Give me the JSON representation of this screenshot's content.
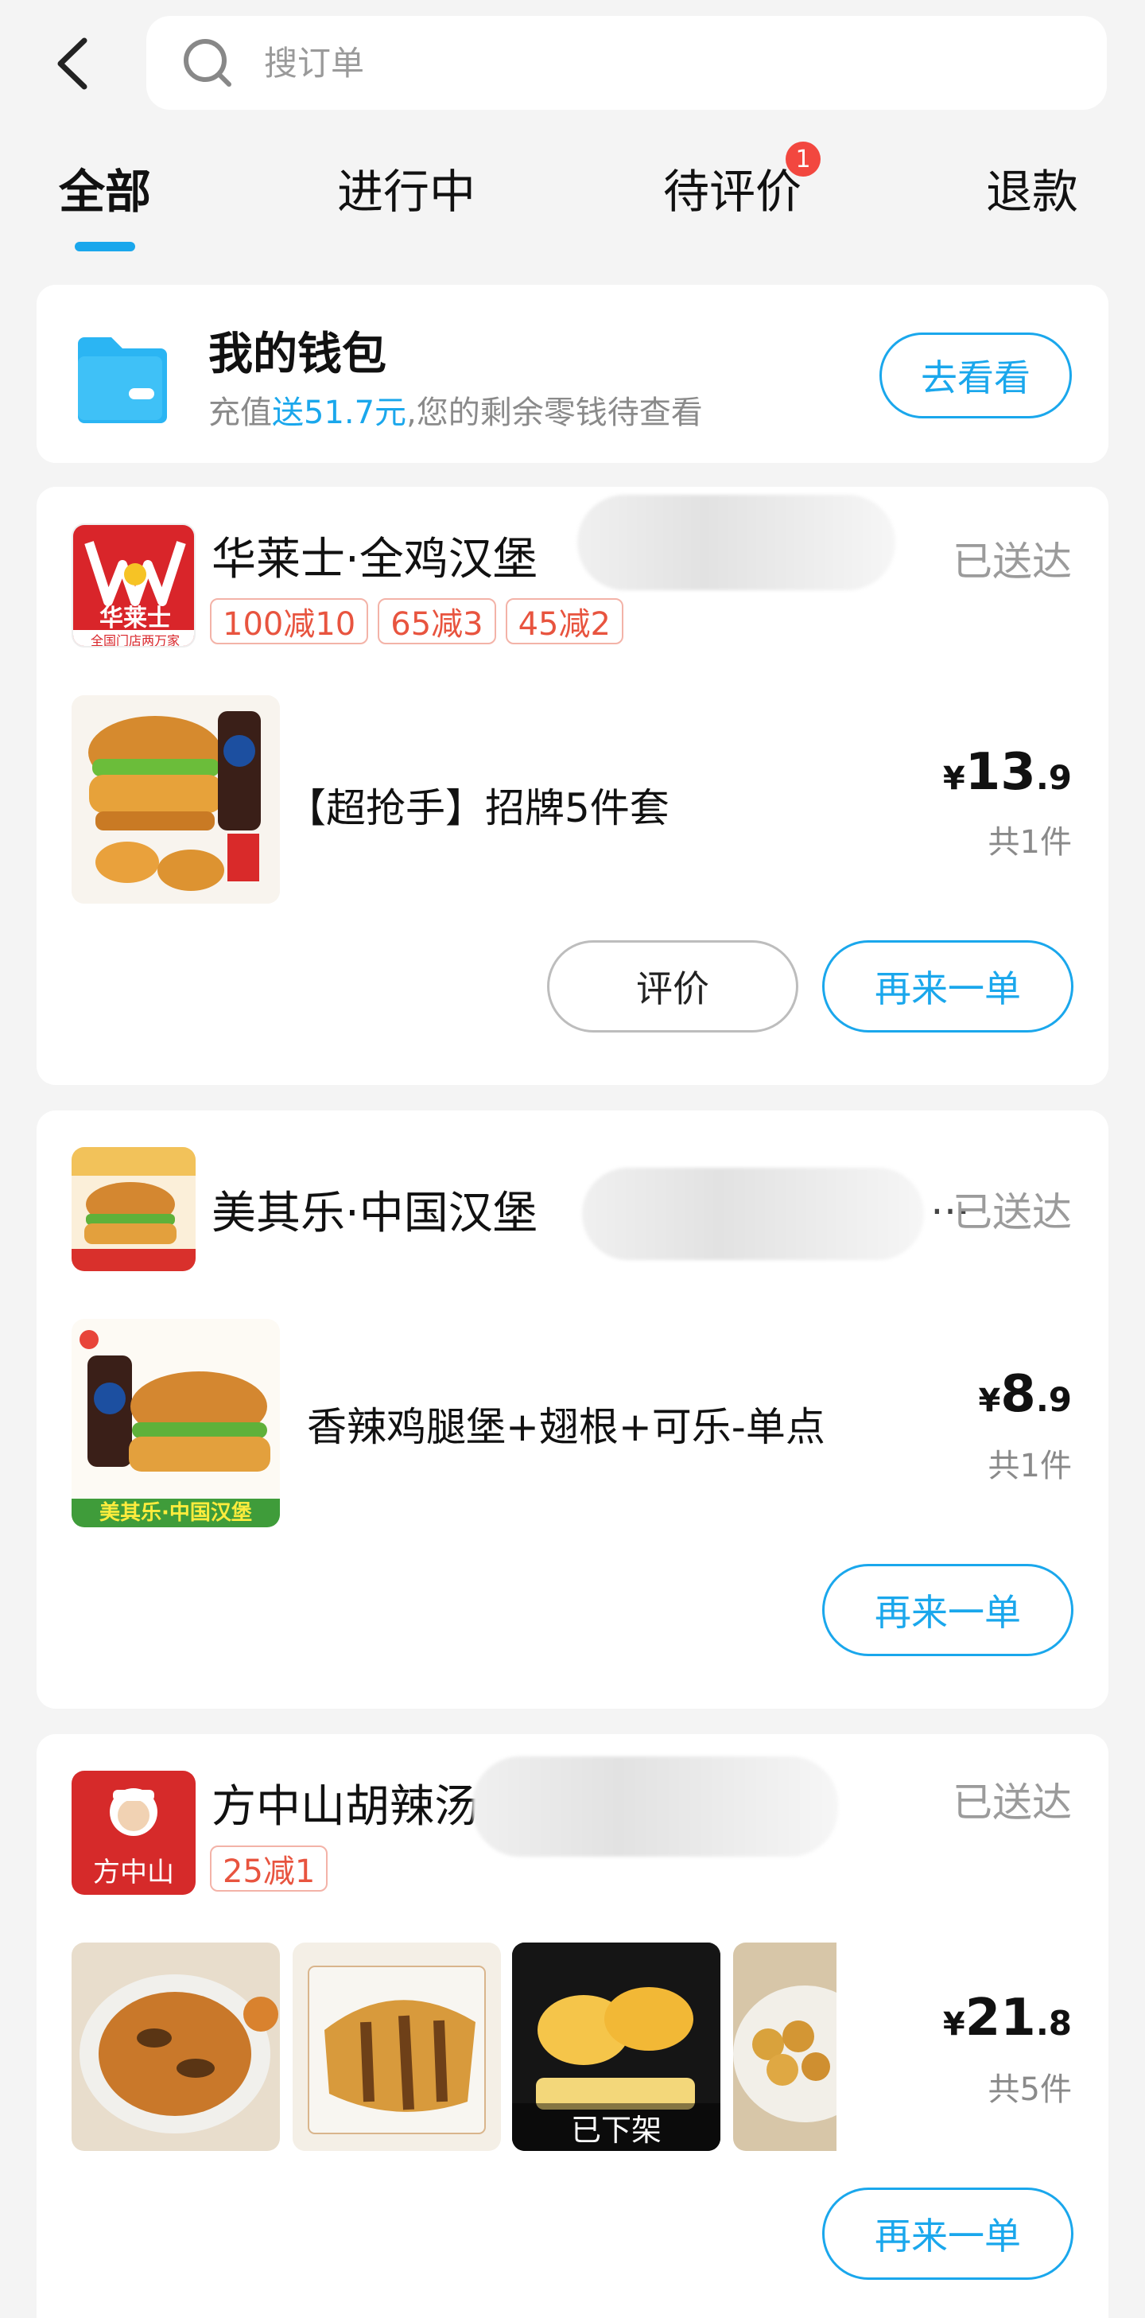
{
  "search": {
    "placeholder": "搜订单"
  },
  "tabs": [
    {
      "label": "全部",
      "active": true
    },
    {
      "label": "进行中"
    },
    {
      "label": "待评价",
      "badge": "1"
    },
    {
      "label": "退款"
    }
  ],
  "wallet": {
    "title": "我的钱包",
    "sub_prefix": "充值",
    "sub_highlight": "送51.7元",
    "sub_suffix": ",您的剩余零钱待查看",
    "button": "去看看"
  },
  "orders": [
    {
      "store": "华莱士·全鸡汉堡",
      "logo_text": "华莱士",
      "logo_caption": "全国门店两万家",
      "status": "已送达",
      "promos": [
        "100减10",
        "65减3",
        "45减2"
      ],
      "item": "【超抢手】招牌5件套",
      "price_currency": "¥",
      "price_int": "13",
      "price_dec": ".9",
      "count": "共1件",
      "buttons": [
        "评价",
        "再来一单"
      ]
    },
    {
      "store": "美其乐·中国汉堡",
      "ellipsis": "…",
      "logo_text": "美其乐·中国汉堡",
      "thumb_caption": "美其乐·中国汉堡",
      "status": "已送达",
      "item": "香辣鸡腿堡+翅根+可乐-单点",
      "price_currency": "¥",
      "price_int": "8",
      "price_dec": ".9",
      "count": "共1件",
      "buttons": [
        "再来一单"
      ]
    },
    {
      "store": "方中山胡辣汤",
      "logo_text": "方中山",
      "status": "已送达",
      "promos": [
        "25减1"
      ],
      "offshelf": "已下架",
      "price_currency": "¥",
      "price_int": "21",
      "price_dec": ".8",
      "count": "共5件",
      "buttons": [
        "再来一单"
      ]
    }
  ]
}
